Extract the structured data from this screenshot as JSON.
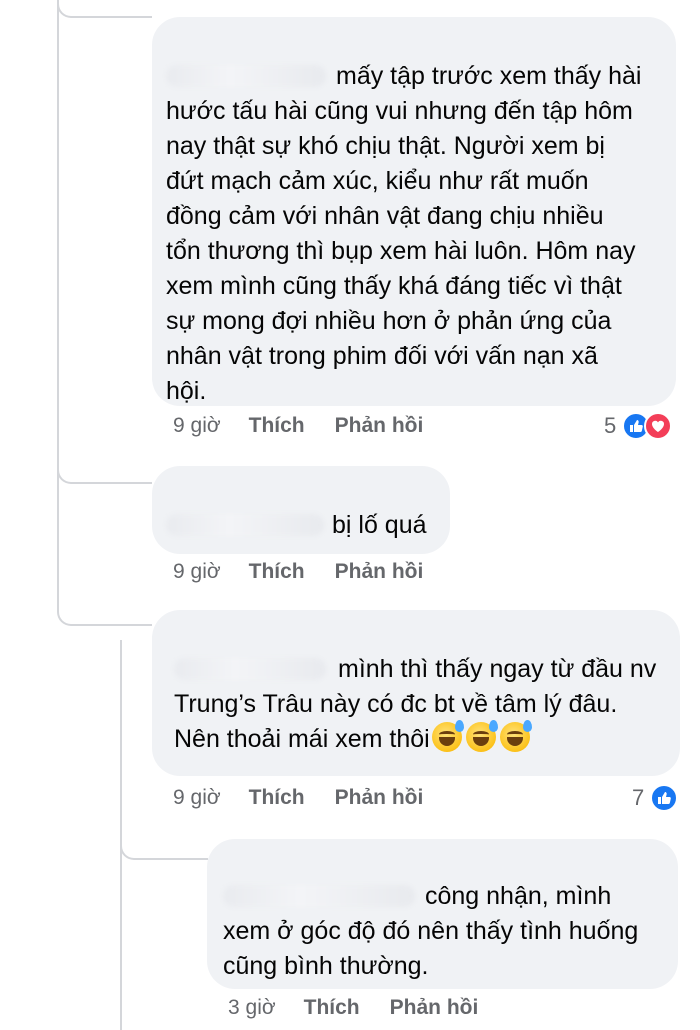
{
  "comments": [
    {
      "text": "mấy tập trước xem thấy hài\nhước tấu hài cũng vui nhưng đến tập hôm\nnay thật sự khó chịu thật. Người xem bị\nđứt mạch cảm xúc, kiểu như rất muốn\nđồng cảm với nhân vật đang chịu nhiều\ntổn thương thì bụp xem hài luôn. Hôm nay\nxem mình cũng thấy khá đáng tiếc vì thật\nsự mong đợi nhiều hơn ở phản ứng của\nnhân vật trong phim đối với vấn nạn xã\nhội.",
      "time": "9 giờ",
      "like_label": "Thích",
      "reply_label": "Phản hồi",
      "reaction_count": "5",
      "reactions": [
        "like-icon",
        "love-icon"
      ]
    },
    {
      "text": "bị lố quá",
      "time": "9 giờ",
      "like_label": "Thích",
      "reply_label": "Phản hồi"
    },
    {
      "text_line1": "mình thì thấy ngay từ đầu nv",
      "text_line2": "Trung’s Trâu này có đc bt về tâm lý đâu.",
      "text_line3": "Nên thoải mái xem thôi",
      "emojis": [
        "grinning-sweat-emoji",
        "grinning-sweat-emoji",
        "grinning-sweat-emoji"
      ],
      "time": "9 giờ",
      "like_label": "Thích",
      "reply_label": "Phản hồi",
      "reaction_count": "7",
      "reactions": [
        "like-icon"
      ]
    },
    {
      "text": "công nhận, mình\nxem ở góc độ đó nên thấy tình huống\ncũng bình thường.",
      "time": "3 giờ",
      "like_label": "Thích",
      "reply_label": "Phản hồi"
    }
  ],
  "colors": {
    "bubble": "#f0f2f5",
    "meta_text": "#65676b",
    "like_blue": "#1877f2",
    "love_red": "#f33e58",
    "thread_line": "#d4d6da"
  }
}
